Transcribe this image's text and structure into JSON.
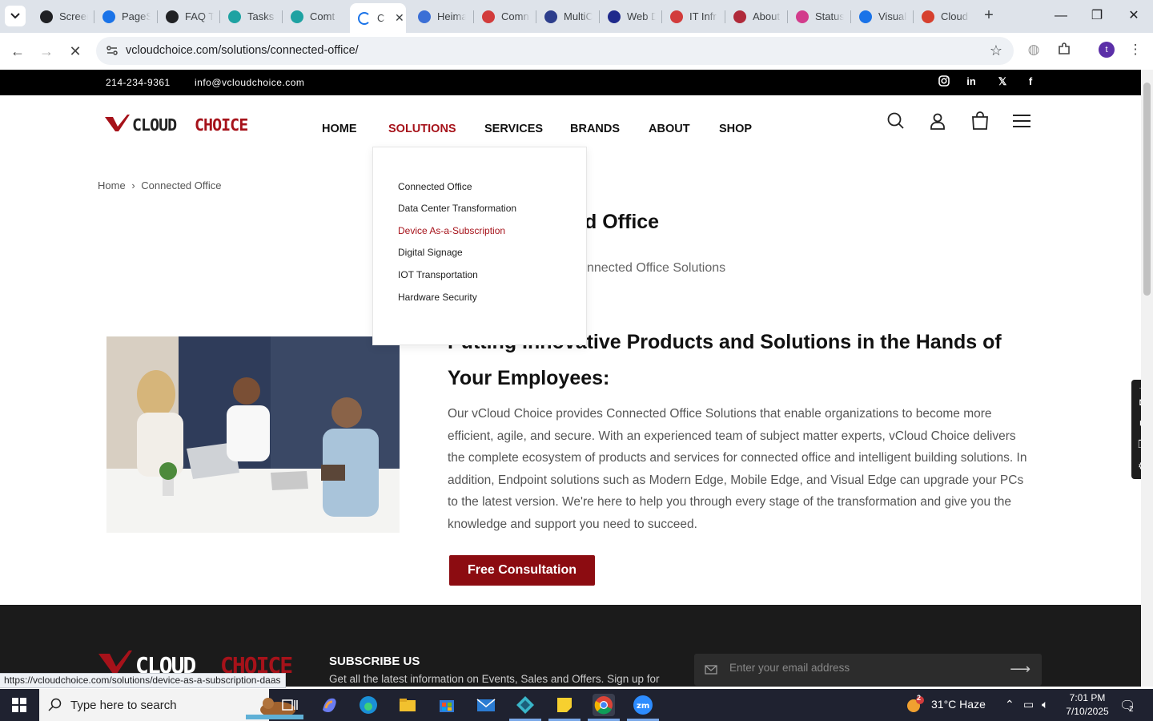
{
  "browser": {
    "tabs": [
      {
        "title": "Screen",
        "color": "#202124"
      },
      {
        "title": "PageS",
        "color": "#1a73e8"
      },
      {
        "title": "FAQ T",
        "color": "#202124"
      },
      {
        "title": "Tasks",
        "color": "#1ea2a2"
      },
      {
        "title": "Comt",
        "color": "#1ea2a2"
      },
      {
        "title": "C",
        "color": "#1a73e8"
      },
      {
        "title": "Heima",
        "color": "#3b6fd6"
      },
      {
        "title": "Comn",
        "color": "#d23c3c"
      },
      {
        "title": "MultiC",
        "color": "#2d3e8c"
      },
      {
        "title": "Web D",
        "color": "#1f2a8c"
      },
      {
        "title": "IT Infr",
        "color": "#d23c3c"
      },
      {
        "title": "About",
        "color": "#b02a3a"
      },
      {
        "title": "Status",
        "color": "#d23c8c"
      },
      {
        "title": "Visual",
        "color": "#1a73e8"
      },
      {
        "title": "Cloud",
        "color": "#d6402e"
      }
    ],
    "url": "vcloudchoice.com/solutions/connected-office/",
    "profile_initial": "t",
    "status_url": "https://vcloudchoice.com/solutions/device-as-a-subscription-daas"
  },
  "site": {
    "phone": "214-234-9361",
    "email": "info@vcloudchoice.com",
    "logo_text": "VCLOUDCHOICE",
    "nav": [
      "HOME",
      "SOLUTIONS",
      "SERVICES",
      "BRANDS",
      "ABOUT",
      "SHOP"
    ],
    "active_nav": "SOLUTIONS",
    "brand_color": "#a6121a"
  },
  "dropdown": {
    "items": [
      "Connected Office",
      "Data Center Transformation",
      "Device As-a-Subscription",
      "Digital Signage",
      "IOT Transportation",
      "Hardware Security"
    ],
    "hovered": "Device As-a-Subscription"
  },
  "breadcrumb": {
    "home": "Home",
    "sep": "›",
    "current": "Connected Office"
  },
  "hero": {
    "title_visible": "d Office",
    "subtitle_visible": "nnected Office Solutions"
  },
  "content": {
    "heading": "Putting Innovative Products and Solutions in the Hands of Your Employees:",
    "body": "Our vCloud Choice provides Connected Office Solutions that enable organizations to become more efficient, agile, and secure. With an experienced team of subject matter experts, vCloud Choice delivers the complete ecosystem of products and services for connected office and intelligent building solutions. In addition, Endpoint solutions such as Modern Edge, Mobile Edge, and Visual Edge can upgrade your PCs to the latest version. We're here to help you through every stage of the transformation and give you the knowledge and support you need to succeed.",
    "cta": "Free Consultation"
  },
  "footer": {
    "subscribe_title": "SUBSCRIBE US",
    "subscribe_desc": "Get all the latest information on Events, Sales and Offers. Sign up for",
    "email_placeholder": "Enter your email address"
  },
  "taskbar": {
    "search_placeholder": "Type here to search",
    "weather": "31°C  Haze",
    "weather_badge": "2",
    "time": "7:01 PM",
    "date": "7/10/2025",
    "notifications": "2"
  }
}
